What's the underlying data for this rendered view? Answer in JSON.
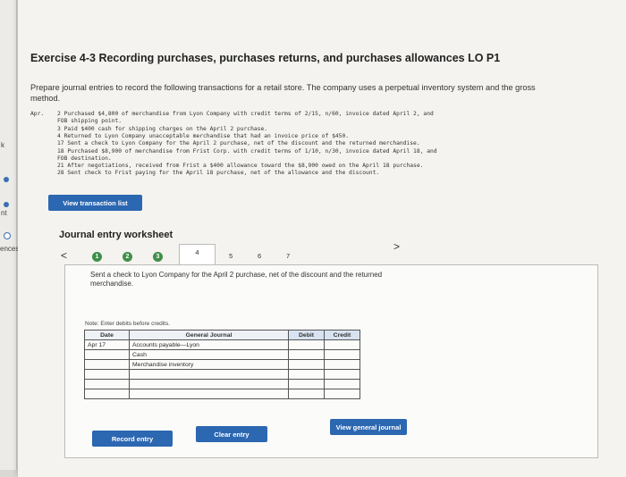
{
  "left_strip": {
    "labels": [
      "k",
      "nt",
      "ences"
    ]
  },
  "exercise": {
    "title": "Exercise 4-3 Recording purchases, purchases returns, and purchases allowances LO P1",
    "intro": "Prepare journal entries to record the following transactions for a retail store. The company uses a perpetual inventory system and the gross method.",
    "month": "Apr.",
    "transactions": [
      "2 Purchased $4,800 of merchandise from Lyon Company with credit terms of 2/15, n/60, invoice dated April 2, and",
      "  FOB shipping point.",
      "3 Paid $400 cash for shipping charges on the April 2 purchase.",
      "4 Returned to Lyon Company unacceptable merchandise that had an invoice price of $450.",
      "17 Sent a check to Lyon Company for the April 2 purchase, net of the discount and the returned merchandise.",
      "18 Purchased $8,900 of merchandise from Frist Corp. with credit terms of 1/10, n/30, invoice dated April 18, and",
      "  FOB destination.",
      "21 After negotiations, received from Frist a $400 allowance toward the $8,900 owed on the April 18 purchase.",
      "28 Sent check to Frist paying for the April 18 purchase, net of the allowance and the discount."
    ],
    "view_transaction_list": "View transaction list"
  },
  "worksheet": {
    "title": "Journal entry worksheet",
    "prev_arrow": "<",
    "next_arrow": ">",
    "steps": [
      "1",
      "2",
      "3",
      "4",
      "5",
      "6",
      "7"
    ],
    "prompt": "Sent a check to Lyon Company for the April 2 purchase, net of the discount and the returned merchandise.",
    "note": "Note: Enter debits before credits.",
    "table_headers": {
      "date": "Date",
      "account": "General Journal",
      "debit": "Debit",
      "credit": "Credit"
    },
    "rows": [
      {
        "date": "Apr 17",
        "account": "Accounts payable—Lyon",
        "debit": "",
        "credit": ""
      },
      {
        "date": "",
        "account": "Cash",
        "debit": "",
        "credit": ""
      },
      {
        "date": "",
        "account": "Merchandise inventory",
        "debit": "",
        "credit": ""
      },
      {
        "date": "",
        "account": "",
        "debit": "",
        "credit": ""
      },
      {
        "date": "",
        "account": "",
        "debit": "",
        "credit": ""
      },
      {
        "date": "",
        "account": "",
        "debit": "",
        "credit": ""
      }
    ],
    "record_entry": "Record entry",
    "clear_entry": "Clear entry",
    "view_general_journal": "View general journal"
  }
}
